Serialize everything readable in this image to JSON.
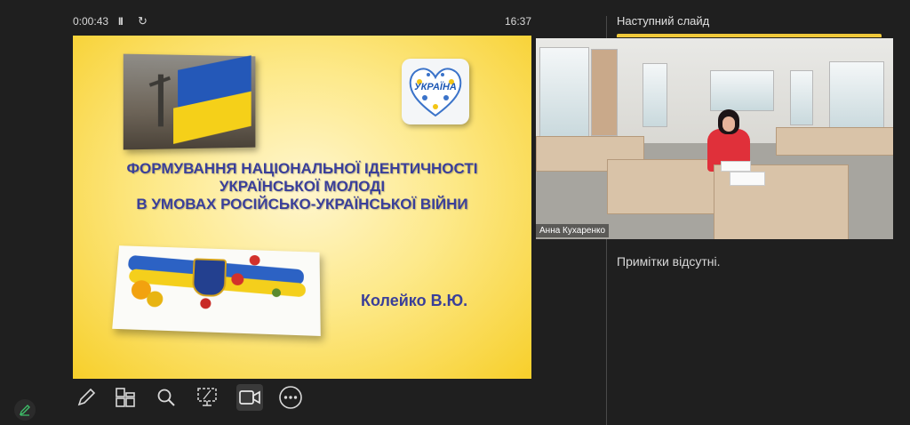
{
  "timer": {
    "elapsed": "0:00:43",
    "pause_glyph": "II",
    "restart_glyph": "↻",
    "clock": "16:37"
  },
  "slide": {
    "badge_text": "УКРАЇНА",
    "title_lines": [
      "ФОРМУВАННЯ НАЦІОНАЛЬНОЇ ІДЕНТИЧНОСТІ",
      "УКРАЇНСЬКОЇ МОЛОДІ",
      "В УМОВАХ РОСІЙСЬКО-УКРАЇНСЬКОЇ ВІЙНИ"
    ],
    "author": "Колейко В.Ю."
  },
  "toolbar": {
    "tools": [
      {
        "icon": "pen-icon",
        "active": false
      },
      {
        "icon": "slides-grid-icon",
        "active": false
      },
      {
        "icon": "magnifier-icon",
        "active": false
      },
      {
        "icon": "subtitles-screen-icon",
        "active": false
      },
      {
        "icon": "camera-icon",
        "active": true
      },
      {
        "icon": "more-options-icon",
        "active": false
      }
    ]
  },
  "side": {
    "next_slide_label": "Наступний слайд",
    "participant_name": "Анна Кухаренко",
    "notes_text": "Примітки відсутні."
  },
  "colors": {
    "background": "#1f1f1f",
    "slide_title": "#3a3f99",
    "accent_yellow": "#f0c93a",
    "active_tool": "#3a3a3a"
  }
}
